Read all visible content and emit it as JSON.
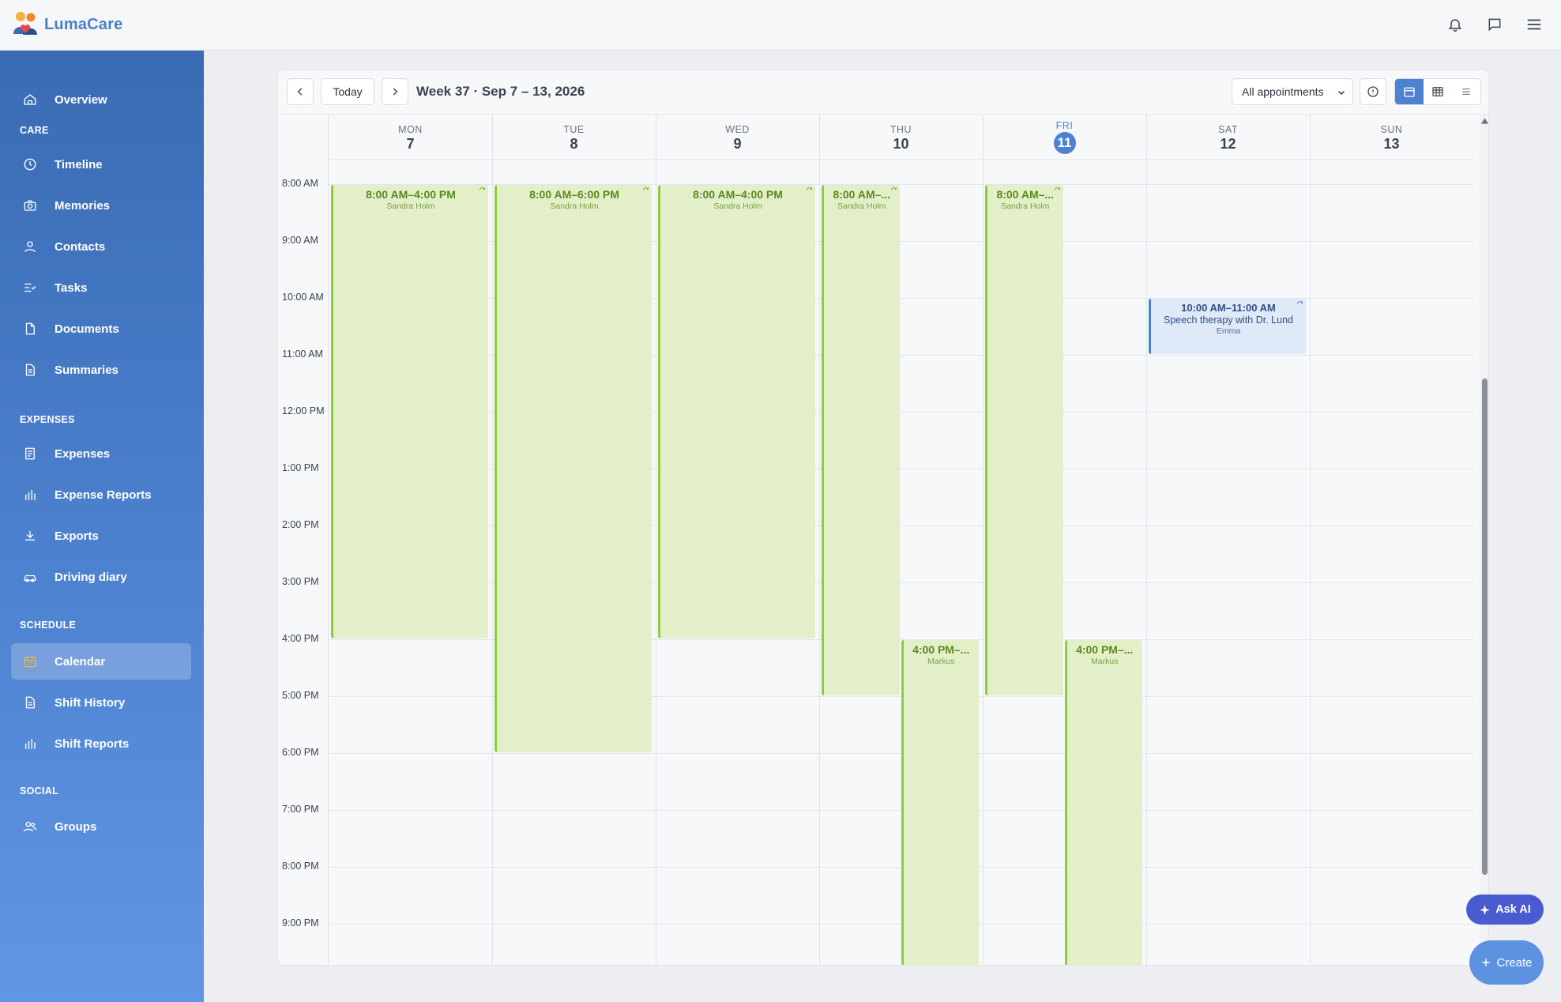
{
  "app": {
    "name": "LumaCare"
  },
  "sidebar": {
    "top": [
      {
        "label": "Overview",
        "icon": "home-icon"
      }
    ],
    "sections": [
      {
        "title": "CARE",
        "items": [
          {
            "label": "Timeline",
            "icon": "clock-icon"
          },
          {
            "label": "Memories",
            "icon": "camera-icon"
          },
          {
            "label": "Contacts",
            "icon": "person-icon"
          },
          {
            "label": "Tasks",
            "icon": "tasks-icon"
          },
          {
            "label": "Documents",
            "icon": "document-icon"
          },
          {
            "label": "Summaries",
            "icon": "summary-icon"
          }
        ]
      },
      {
        "title": "EXPENSES",
        "items": [
          {
            "label": "Expenses",
            "icon": "receipt-icon"
          },
          {
            "label": "Expense Reports",
            "icon": "bar-chart-icon"
          },
          {
            "label": "Exports",
            "icon": "download-icon"
          },
          {
            "label": "Driving diary",
            "icon": "car-icon"
          }
        ]
      },
      {
        "title": "SCHEDULE",
        "items": [
          {
            "label": "Calendar",
            "icon": "calendar-icon",
            "active": true
          },
          {
            "label": "Shift History",
            "icon": "document-icon"
          },
          {
            "label": "Shift Reports",
            "icon": "bar-chart-icon"
          }
        ]
      },
      {
        "title": "SOCIAL",
        "items": [
          {
            "label": "Groups",
            "icon": "group-icon"
          }
        ]
      }
    ]
  },
  "toolbar": {
    "today_label": "Today",
    "week_title": "Week 37 · Sep 7 – 13, 2026",
    "filter_value": "All appointments",
    "view_modes": [
      "week",
      "month",
      "list"
    ],
    "active_view": "week"
  },
  "days": [
    {
      "name": "MON",
      "date": "7"
    },
    {
      "name": "TUE",
      "date": "8"
    },
    {
      "name": "WED",
      "date": "9"
    },
    {
      "name": "THU",
      "date": "10"
    },
    {
      "name": "FRI",
      "date": "11",
      "today": true
    },
    {
      "name": "SAT",
      "date": "12"
    },
    {
      "name": "SUN",
      "date": "13"
    }
  ],
  "hours": [
    "8:00 AM",
    "9:00 AM",
    "10:00 AM",
    "11:00 AM",
    "12:00 PM",
    "1:00 PM",
    "2:00 PM",
    "3:00 PM",
    "4:00 PM",
    "5:00 PM",
    "6:00 PM",
    "7:00 PM",
    "8:00 PM",
    "9:00 PM"
  ],
  "events": [
    {
      "day": 0,
      "start": 8,
      "end": 16,
      "time": "8:00 AM–4:00 PM",
      "person": "Sandra Holm",
      "type": "shift",
      "col": 0,
      "cols": 1
    },
    {
      "day": 1,
      "start": 8,
      "end": 18,
      "time": "8:00 AM–6:00 PM",
      "person": "Sandra Holm",
      "type": "shift",
      "col": 0,
      "cols": 1
    },
    {
      "day": 2,
      "start": 8,
      "end": 16,
      "time": "8:00 AM–4:00 PM",
      "person": "Sandra Holm",
      "type": "shift",
      "col": 0,
      "cols": 1
    },
    {
      "day": 3,
      "start": 8,
      "end": 17,
      "time": "8:00 AM–...",
      "person": "Sandra Holm",
      "type": "shift",
      "col": 0,
      "cols": 2
    },
    {
      "day": 3,
      "start": 16,
      "end": 22,
      "time": "4:00 PM–...",
      "person": "Markus",
      "type": "shift",
      "col": 1,
      "cols": 2
    },
    {
      "day": 4,
      "start": 8,
      "end": 17,
      "time": "8:00 AM–...",
      "person": "Sandra Holm",
      "type": "shift",
      "col": 0,
      "cols": 2
    },
    {
      "day": 4,
      "start": 16,
      "end": 22,
      "time": "4:00 PM–...",
      "person": "Markus",
      "type": "shift",
      "col": 1,
      "cols": 2
    },
    {
      "day": 5,
      "start": 10,
      "end": 11,
      "time": "10:00 AM–11:00 AM",
      "title": "Speech therapy with Dr. Lund",
      "person": "Emma",
      "type": "appointment",
      "col": 0,
      "cols": 1
    }
  ],
  "floating": {
    "ask_ai_label": "Ask AI",
    "create_label": "Create"
  },
  "colors": {
    "accent": "#4d82d0",
    "shift_bg": "#e3efc9",
    "shift_border": "#8ccc3e",
    "appointment_bg": "#e0e9f7"
  }
}
